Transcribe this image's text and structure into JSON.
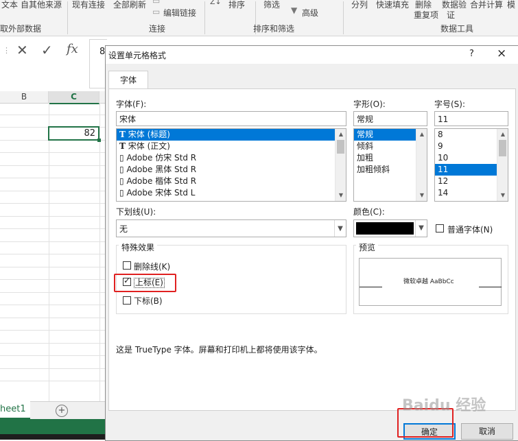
{
  "ribbon": {
    "items": [
      "文本",
      "自其他来源",
      "现有连接",
      "全部刷新",
      "编辑链接",
      "排序",
      "筛选",
      "高级",
      "分列",
      "快速填充",
      "删除",
      "重复项",
      "数据验",
      "证",
      "合并计算",
      "模"
    ],
    "groups": [
      "取外部数据",
      "连接",
      "排序和筛选",
      "数据工具"
    ]
  },
  "formula_bar": {
    "value": "8"
  },
  "sheet": {
    "col_b": "B",
    "col_c": "C",
    "cell_value": "82",
    "tab": "heet1",
    "add_sheet": "+"
  },
  "dialog": {
    "title": "设置单元格格式",
    "help": "?",
    "close": "×",
    "tab": "字体",
    "font_label": "字体(F):",
    "font_value": "宋体",
    "fonts": [
      "宋体 (标题)",
      "宋体 (正文)",
      "Adobe 仿宋 Std R",
      "Adobe 黑体 Std R",
      "Adobe 楷体 Std R",
      "Adobe 宋体 Std L"
    ],
    "font_icons": [
      "T",
      "T",
      "▯",
      "▯",
      "▯",
      "▯"
    ],
    "style_label": "字形(O):",
    "style_value": "常规",
    "styles": [
      "常规",
      "倾斜",
      "加粗",
      "加粗倾斜"
    ],
    "size_label": "字号(S):",
    "size_value": "11",
    "sizes": [
      "8",
      "9",
      "10",
      "11",
      "12",
      "14"
    ],
    "underline_label": "下划线(U):",
    "underline_value": "无",
    "color_label": "颜色(C):",
    "color_value": "#000000",
    "normal_font_label": "普通字体(N)",
    "effects_label": "特殊效果",
    "strike_label": "删除线(K)",
    "super_label": "上标(E)",
    "sub_label": "下标(B)",
    "preview_label": "预览",
    "preview_text": "微软卓越 AaBbCc",
    "info_text": "这是 TrueType 字体。屏幕和打印机上都将使用该字体。",
    "ok": "确定",
    "cancel": "取消"
  },
  "watermark": "Baidu 经验",
  "colors": {
    "selection": "#0078d7",
    "highlight": "#e02020",
    "excel_green": "#217346"
  }
}
